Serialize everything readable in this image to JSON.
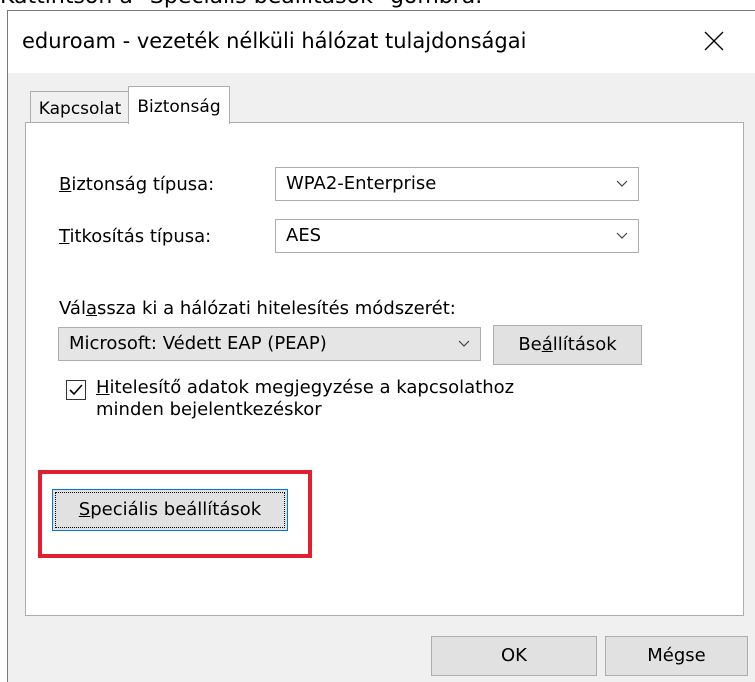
{
  "caption": "Kattintson a \"Speciális beállítások\" gombra.",
  "window": {
    "title": "eduroam - vezeték nélküli hálózat tulajdonságai",
    "close_icon": "close-icon"
  },
  "tabs": [
    {
      "label": "Kapcsolat",
      "active": false
    },
    {
      "label": "Biztonság",
      "active": true
    }
  ],
  "security": {
    "type_label_first": "B",
    "type_label_rest": "iztonság típusa:",
    "type_value": "WPA2-Enterprise",
    "encryption_label_first": "T",
    "encryption_label_rest": "itkosítás típusa:",
    "encryption_value": "AES"
  },
  "auth": {
    "label_pre": "Vál",
    "label_u": "a",
    "label_post": "ssza ki a hálózati hitelesítés módszerét:",
    "method_value": "Microsoft: Védett EAP (PEAP)",
    "settings_pre": "Be",
    "settings_u": "á",
    "settings_post": "llítások"
  },
  "remember": {
    "checked": true,
    "line1_u": "H",
    "line1_rest": "itelesítő adatok megjegyzése a kapcsolathoz",
    "line2": "minden bejelentkezéskor"
  },
  "advanced": {
    "label_u": "S",
    "label_rest": "peciális beállítások"
  },
  "footer": {
    "ok": "OK",
    "cancel": "Mégse"
  },
  "colors": {
    "highlight": "#e0202e",
    "focus": "#0078d7"
  }
}
